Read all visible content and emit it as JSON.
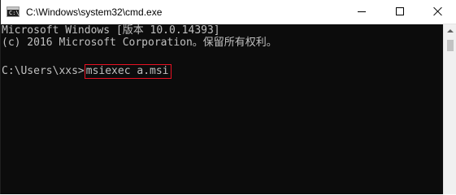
{
  "window": {
    "title": "C:\\Windows\\system32\\cmd.exe",
    "icon": "cmd-console-icon",
    "icon_text": "C:\\"
  },
  "console": {
    "lines": [
      "Microsoft Windows [版本 10.0.14393]",
      "(c) 2016 Microsoft Corporation。保留所有权利。"
    ],
    "prompt": "C:\\Users\\xxs>",
    "command": "msiexec a.msi"
  },
  "colors": {
    "console_background": "#0c0c0c",
    "console_text": "#c0c0c0",
    "highlight_border": "#e81123"
  }
}
